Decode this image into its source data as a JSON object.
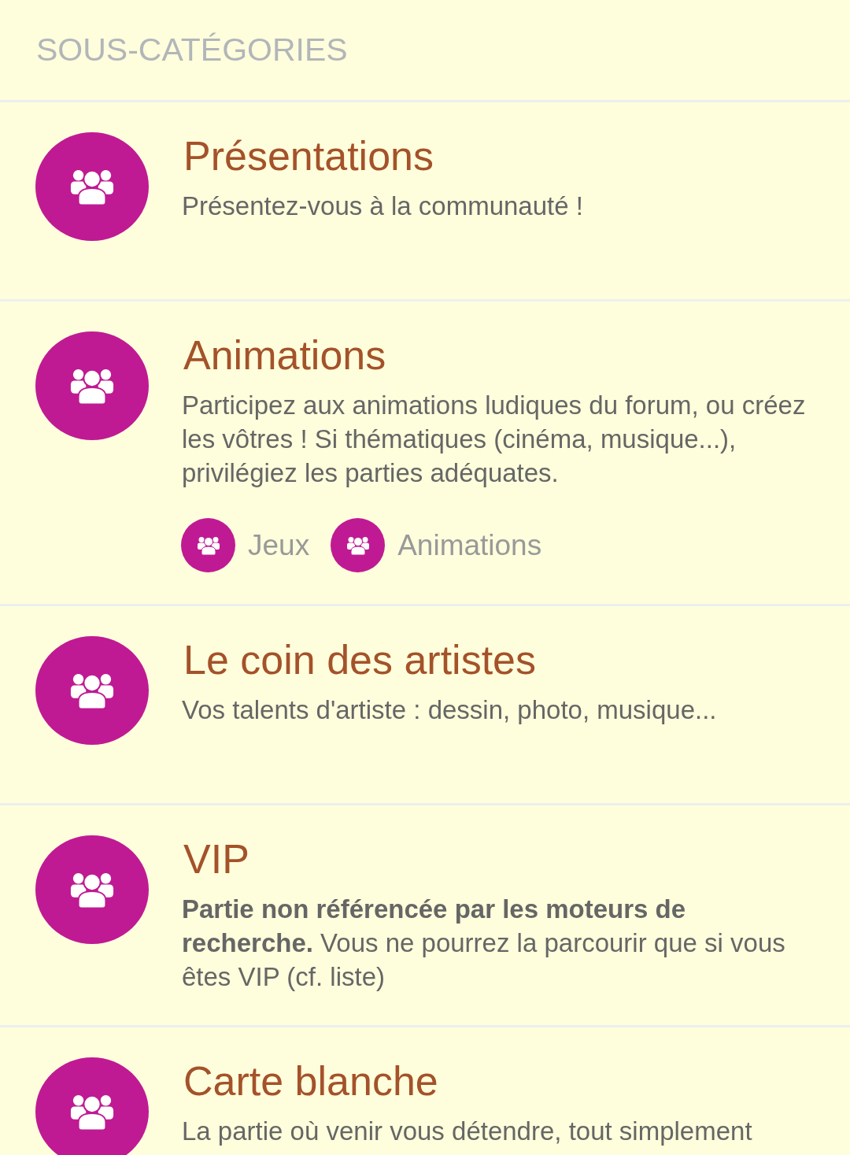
{
  "heading": "SOUS-CATÉGORIES",
  "forums": [
    {
      "title": "Présentations",
      "description": "Présentez-vous à la communauté !"
    },
    {
      "title": "Animations",
      "description": "Participez aux animations ludiques du forum, ou créez les vôtres ! Si thématiques (cinéma, musique...), privilégiez les parties adéquates.",
      "subforums": [
        {
          "label": "Jeux"
        },
        {
          "label": "Animations"
        }
      ]
    },
    {
      "title": "Le coin des artistes",
      "description": "Vos talents d'artiste : dessin, photo, musique..."
    },
    {
      "title": "VIP",
      "description": "**Partie non référencée par les moteurs de recherche.** Vous ne pourrez la parcourir que si vous êtes VIP (cf. liste)"
    },
    {
      "title": "Carte blanche",
      "description": "La partie où venir vous détendre, tout simplement"
    }
  ]
}
